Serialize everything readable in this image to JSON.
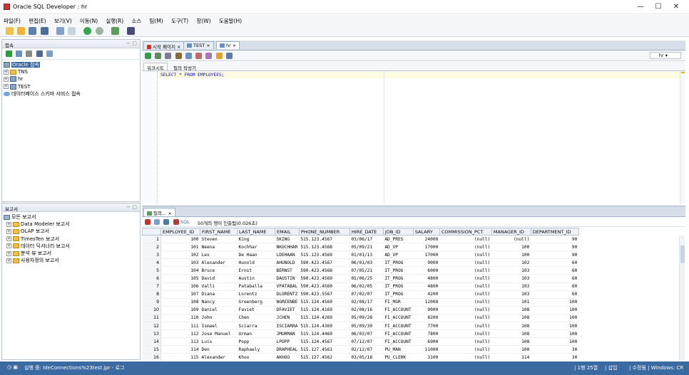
{
  "window": {
    "title": "Oracle SQL Developer : hr",
    "minimize": "—",
    "maximize": "☐",
    "close": "✕"
  },
  "menu": [
    "파일(F)",
    "편집(E)",
    "보기(V)",
    "이동(N)",
    "실행(R)",
    "소스",
    "팀(M)",
    "도구(T)",
    "창(W)",
    "도움말(H)"
  ],
  "connections": {
    "header": "접속",
    "items": [
      {
        "label": "Oracle 접속"
      },
      {
        "label": "TNS"
      },
      {
        "label": "hr"
      },
      {
        "label": "TEST"
      },
      {
        "label": "데이터베이스 스키마 서비스 접속"
      }
    ]
  },
  "reports": {
    "header": "보고서",
    "items": [
      {
        "label": "모든 보고서"
      },
      {
        "label": "Data Modeler 보고서"
      },
      {
        "label": "OLAP 보고서"
      },
      {
        "label": "TimesTen 보고서"
      },
      {
        "label": "데이터 딕셔너리 보고서"
      },
      {
        "label": "분석 뷰 보고서"
      },
      {
        "label": "사용자정의 보고서"
      }
    ]
  },
  "doc_tabs": [
    "시작 페이지",
    "TEST",
    "hr"
  ],
  "connection_select": "hr",
  "subtabs": {
    "worksheet": "워크시트",
    "query_builder": "질의 작성기"
  },
  "sql": "SELECT * FROM EMPLOYEES;",
  "results": {
    "tab_label": "질의...",
    "status_sql": "SQL",
    "status_text": "50개의 행이 인출됨(0.026초)",
    "columns": [
      "EMPLOYEE_ID",
      "FIRST_NAME",
      "LAST_NAME",
      "EMAIL",
      "PHONE_NUMBER",
      "HIRE_DATE",
      "JOB_ID",
      "SALARY",
      "COMMISSION_PCT",
      "MANAGER_ID",
      "DEPARTMENT_ID"
    ],
    "rows": [
      [
        "1",
        "100",
        "Steven",
        "King",
        "SKING",
        "515.123.4567",
        "03/06/17",
        "AD_PRES",
        "24000",
        "(null)",
        "(null)",
        "90"
      ],
      [
        "2",
        "101",
        "Neena",
        "Kochhar",
        "NKOCHHAR",
        "515.123.4568",
        "05/09/21",
        "AD_VP",
        "17000",
        "(null)",
        "100",
        "90"
      ],
      [
        "3",
        "102",
        "Lex",
        "De Haan",
        "LDEHAAN",
        "515.123.4569",
        "01/01/13",
        "AD_VP",
        "17000",
        "(null)",
        "100",
        "90"
      ],
      [
        "4",
        "103",
        "Alexander",
        "Hunold",
        "AHUNOLD",
        "590.423.4567",
        "06/01/03",
        "IT_PROG",
        "9000",
        "(null)",
        "102",
        "60"
      ],
      [
        "5",
        "104",
        "Bruce",
        "Ernst",
        "BERNST",
        "590.423.4568",
        "07/05/21",
        "IT_PROG",
        "6000",
        "(null)",
        "103",
        "60"
      ],
      [
        "6",
        "105",
        "David",
        "Austin",
        "DAUSTIN",
        "590.423.4569",
        "05/06/25",
        "IT_PROG",
        "4800",
        "(null)",
        "103",
        "60"
      ],
      [
        "7",
        "106",
        "Valli",
        "Pataballa",
        "VPATABAL",
        "590.423.4560",
        "06/02/05",
        "IT_PROG",
        "4800",
        "(null)",
        "103",
        "60"
      ],
      [
        "8",
        "107",
        "Diana",
        "Lorentz",
        "DLORENTZ",
        "590.423.5567",
        "07/02/07",
        "IT_PROG",
        "4200",
        "(null)",
        "103",
        "60"
      ],
      [
        "9",
        "108",
        "Nancy",
        "Greenberg",
        "NGREENBE",
        "515.124.4569",
        "02/08/17",
        "FI_MGR",
        "12008",
        "(null)",
        "101",
        "100"
      ],
      [
        "10",
        "109",
        "Daniel",
        "Faviet",
        "DFAVIET",
        "515.124.4169",
        "02/08/16",
        "FI_ACCOUNT",
        "9000",
        "(null)",
        "108",
        "100"
      ],
      [
        "11",
        "110",
        "John",
        "Chen",
        "JCHEN",
        "515.124.4269",
        "05/09/28",
        "FI_ACCOUNT",
        "8200",
        "(null)",
        "108",
        "100"
      ],
      [
        "12",
        "111",
        "Ismael",
        "Sciarra",
        "ISCIARRA",
        "515.124.4369",
        "05/09/30",
        "FI_ACCOUNT",
        "7700",
        "(null)",
        "108",
        "100"
      ],
      [
        "13",
        "112",
        "Jose Manuel",
        "Urman",
        "JMURMAN",
        "515.124.4469",
        "06/03/07",
        "FI_ACCOUNT",
        "7800",
        "(null)",
        "108",
        "100"
      ],
      [
        "14",
        "113",
        "Luis",
        "Popp",
        "LPOPP",
        "515.124.4567",
        "07/12/07",
        "FI_ACCOUNT",
        "6900",
        "(null)",
        "108",
        "100"
      ],
      [
        "15",
        "114",
        "Den",
        "Raphaely",
        "DRAPHEAL",
        "515.127.4561",
        "02/12/07",
        "PU_MAN",
        "11000",
        "(null)",
        "100",
        "30"
      ],
      [
        "16",
        "115",
        "Alexander",
        "Khoo",
        "AKHOO",
        "515.127.4562",
        "03/05/18",
        "PU_CLERK",
        "3100",
        "(null)",
        "114",
        "30"
      ]
    ]
  },
  "statusbar": {
    "left": "실행 중: IdeConnections%23test.jpr - 로그",
    "pos": "| 1행 25열",
    "insert": "| 삽입",
    "mod": "| 수정됨 | Windows: CR"
  },
  "colors": {
    "accent": "#3b6aa0",
    "sql_keyword": "#0000cc",
    "header_bg": "#eef2f7"
  }
}
